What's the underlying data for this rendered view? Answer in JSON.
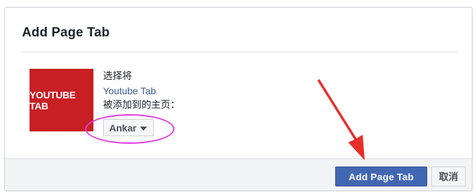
{
  "dialog": {
    "title": "Add Page Tab"
  },
  "app": {
    "logo_text": "YOUTUBE TAB",
    "logo_color": "#c81f24"
  },
  "description": {
    "line1": "选择将",
    "app_name": "Youtube Tab",
    "line3": "被添加到的主页："
  },
  "page_select": {
    "selected": "Ankar",
    "icon": "caret-down-icon"
  },
  "footer": {
    "primary_label": "Add Page Tab",
    "secondary_label": "取消"
  },
  "colors": {
    "primary": "#4267b2",
    "link": "#3b5998",
    "highlight": "#e13ce0",
    "arrow": "#e8302a"
  }
}
